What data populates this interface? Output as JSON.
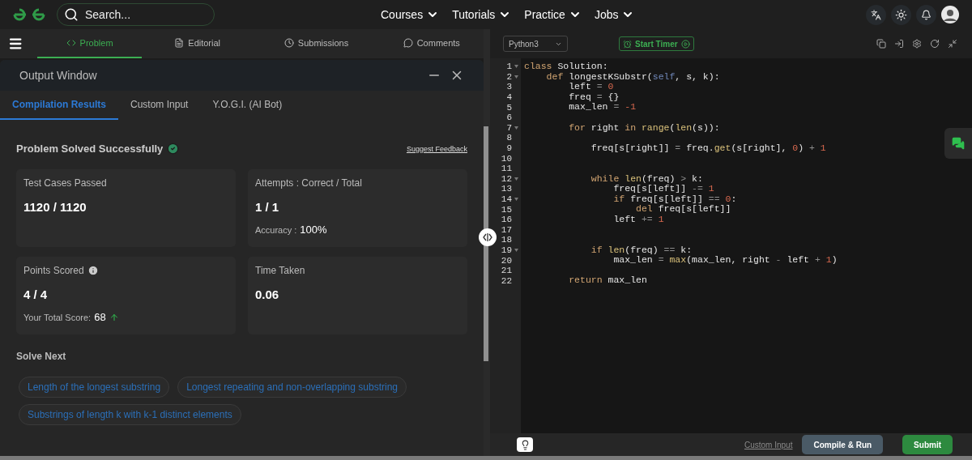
{
  "nav": {
    "search": {
      "placeholder": "Search..."
    },
    "menu": [
      {
        "label": "Courses"
      },
      {
        "label": "Tutorials"
      },
      {
        "label": "Practice"
      },
      {
        "label": "Jobs"
      }
    ]
  },
  "problem_tabs": [
    {
      "label": "Problem",
      "selected": true
    },
    {
      "label": "Editorial",
      "selected": false
    },
    {
      "label": "Submissions",
      "selected": false
    },
    {
      "label": "Comments",
      "selected": false
    }
  ],
  "output_window": {
    "title": "Output Window",
    "tabs": [
      {
        "label": "Compilation Results",
        "selected": true
      },
      {
        "label": "Custom Input",
        "selected": false
      },
      {
        "label": "Y.O.G.I. (AI Bot)",
        "selected": false
      }
    ],
    "status": "Problem Solved Successfully",
    "feedback_link": "Suggest Feedback",
    "cards": [
      {
        "label": "Test Cases Passed",
        "value": "1120 / 1120"
      },
      {
        "label": "Attempts : Correct / Total",
        "value": "1 / 1",
        "sub_label": "Accuracy :",
        "sub_value": "100%"
      },
      {
        "label": "Points Scored",
        "info": true,
        "value": "4 / 4",
        "sub_label": "Your Total Score:",
        "sub_value": "68",
        "rising": true
      },
      {
        "label": "Time Taken",
        "value": "0.06"
      }
    ],
    "solve_next": {
      "title": "Solve Next",
      "links": [
        "Length of the longest substring",
        "Longest repeating and non-overlapping substring",
        "Substrings of length k with k-1 distinct elements"
      ]
    }
  },
  "editor": {
    "language": "Python3",
    "timer": "Start Timer",
    "lines": [
      {
        "number": "1",
        "fold": true,
        "tokens": [
          {
            "kind": "kw",
            "text": "class"
          },
          {
            "kind": "plain",
            "text": " Solution:"
          }
        ]
      },
      {
        "number": "2",
        "fold": true,
        "tokens": [
          {
            "kind": "kw",
            "text": "    def"
          },
          {
            "kind": "plain",
            "text": " longestKSubstr("
          },
          {
            "kind": "self",
            "text": "self"
          },
          {
            "kind": "plain",
            "text": ", s, k):"
          }
        ]
      },
      {
        "number": "3",
        "fold": false,
        "tokens": [
          {
            "kind": "plain",
            "text": "        left "
          },
          {
            "kind": "op",
            "text": "= "
          },
          {
            "kind": "num",
            "text": "0"
          }
        ]
      },
      {
        "number": "4",
        "fold": false,
        "tokens": [
          {
            "kind": "plain",
            "text": "        freq "
          },
          {
            "kind": "op",
            "text": "= "
          },
          {
            "kind": "plain",
            "text": "{}"
          }
        ]
      },
      {
        "number": "5",
        "fold": false,
        "tokens": [
          {
            "kind": "plain",
            "text": "        max_len "
          },
          {
            "kind": "op",
            "text": "= "
          },
          {
            "kind": "num",
            "text": "-1"
          }
        ]
      },
      {
        "number": "6",
        "fold": false
      },
      {
        "number": "7",
        "fold": true,
        "tokens": [
          {
            "kind": "kw",
            "text": "        for"
          },
          {
            "kind": "plain",
            "text": " right "
          },
          {
            "kind": "kw",
            "text": "in "
          },
          {
            "kind": "builtin",
            "text": "range"
          },
          {
            "kind": "plain",
            "text": "("
          },
          {
            "kind": "builtin",
            "text": "len"
          },
          {
            "kind": "plain",
            "text": "(s)):"
          }
        ]
      },
      {
        "number": "8",
        "fold": false
      },
      {
        "number": "9",
        "fold": false,
        "tokens": [
          {
            "kind": "plain",
            "text": "            freq[s[right]] "
          },
          {
            "kind": "op",
            "text": "= "
          },
          {
            "kind": "plain",
            "text": "freq."
          },
          {
            "kind": "builtin",
            "text": "get"
          },
          {
            "kind": "plain",
            "text": "(s[right], "
          },
          {
            "kind": "num",
            "text": "0"
          },
          {
            "kind": "plain",
            "text": ") "
          },
          {
            "kind": "op",
            "text": "+ "
          },
          {
            "kind": "num",
            "text": "1"
          }
        ]
      },
      {
        "number": "10",
        "fold": false
      },
      {
        "number": "11",
        "fold": false
      },
      {
        "number": "12",
        "fold": true,
        "tokens": [
          {
            "kind": "kw",
            "text": "            while "
          },
          {
            "kind": "builtin",
            "text": "len"
          },
          {
            "kind": "plain",
            "text": "(freq) "
          },
          {
            "kind": "op",
            "text": "> "
          },
          {
            "kind": "plain",
            "text": "k:"
          }
        ]
      },
      {
        "number": "13",
        "fold": false,
        "tokens": [
          {
            "kind": "plain",
            "text": "                freq[s[left]] "
          },
          {
            "kind": "op",
            "text": "-= "
          },
          {
            "kind": "num",
            "text": "1"
          }
        ]
      },
      {
        "number": "14",
        "fold": true,
        "tokens": [
          {
            "kind": "kw",
            "text": "                if"
          },
          {
            "kind": "plain",
            "text": " freq[s[left]] "
          },
          {
            "kind": "op",
            "text": "== "
          },
          {
            "kind": "num",
            "text": "0"
          },
          {
            "kind": "plain",
            "text": ":"
          }
        ]
      },
      {
        "number": "15",
        "fold": false,
        "tokens": [
          {
            "kind": "kw",
            "text": "                    del"
          },
          {
            "kind": "plain",
            "text": " freq[s[left]]"
          }
        ]
      },
      {
        "number": "16",
        "fold": false,
        "tokens": [
          {
            "kind": "plain",
            "text": "                left "
          },
          {
            "kind": "op",
            "text": "+= "
          },
          {
            "kind": "num",
            "text": "1"
          }
        ]
      },
      {
        "number": "17",
        "fold": false
      },
      {
        "number": "18",
        "fold": false
      },
      {
        "number": "19",
        "fold": true,
        "tokens": [
          {
            "kind": "kw",
            "text": "            if "
          },
          {
            "kind": "builtin",
            "text": "len"
          },
          {
            "kind": "plain",
            "text": "(freq) "
          },
          {
            "kind": "op",
            "text": "== "
          },
          {
            "kind": "plain",
            "text": "k:"
          }
        ]
      },
      {
        "number": "20",
        "fold": false,
        "tokens": [
          {
            "kind": "plain",
            "text": "                max_len "
          },
          {
            "kind": "op",
            "text": "= "
          },
          {
            "kind": "builtin",
            "text": "max"
          },
          {
            "kind": "plain",
            "text": "(max_len, right "
          },
          {
            "kind": "op",
            "text": "- "
          },
          {
            "kind": "plain",
            "text": "left "
          },
          {
            "kind": "op",
            "text": "+ "
          },
          {
            "kind": "num",
            "text": "1"
          },
          {
            "kind": "plain",
            "text": ")"
          }
        ]
      },
      {
        "number": "21",
        "fold": false
      },
      {
        "number": "22",
        "fold": false,
        "tokens": [
          {
            "kind": "kw",
            "text": "        return"
          },
          {
            "kind": "plain",
            "text": " max_len"
          }
        ]
      }
    ],
    "footer": {
      "custom_input": "Custom Input",
      "buttons": [
        {
          "kind": "run",
          "label": "Compile & Run"
        },
        {
          "kind": "submit",
          "label": "Submit"
        }
      ]
    }
  }
}
